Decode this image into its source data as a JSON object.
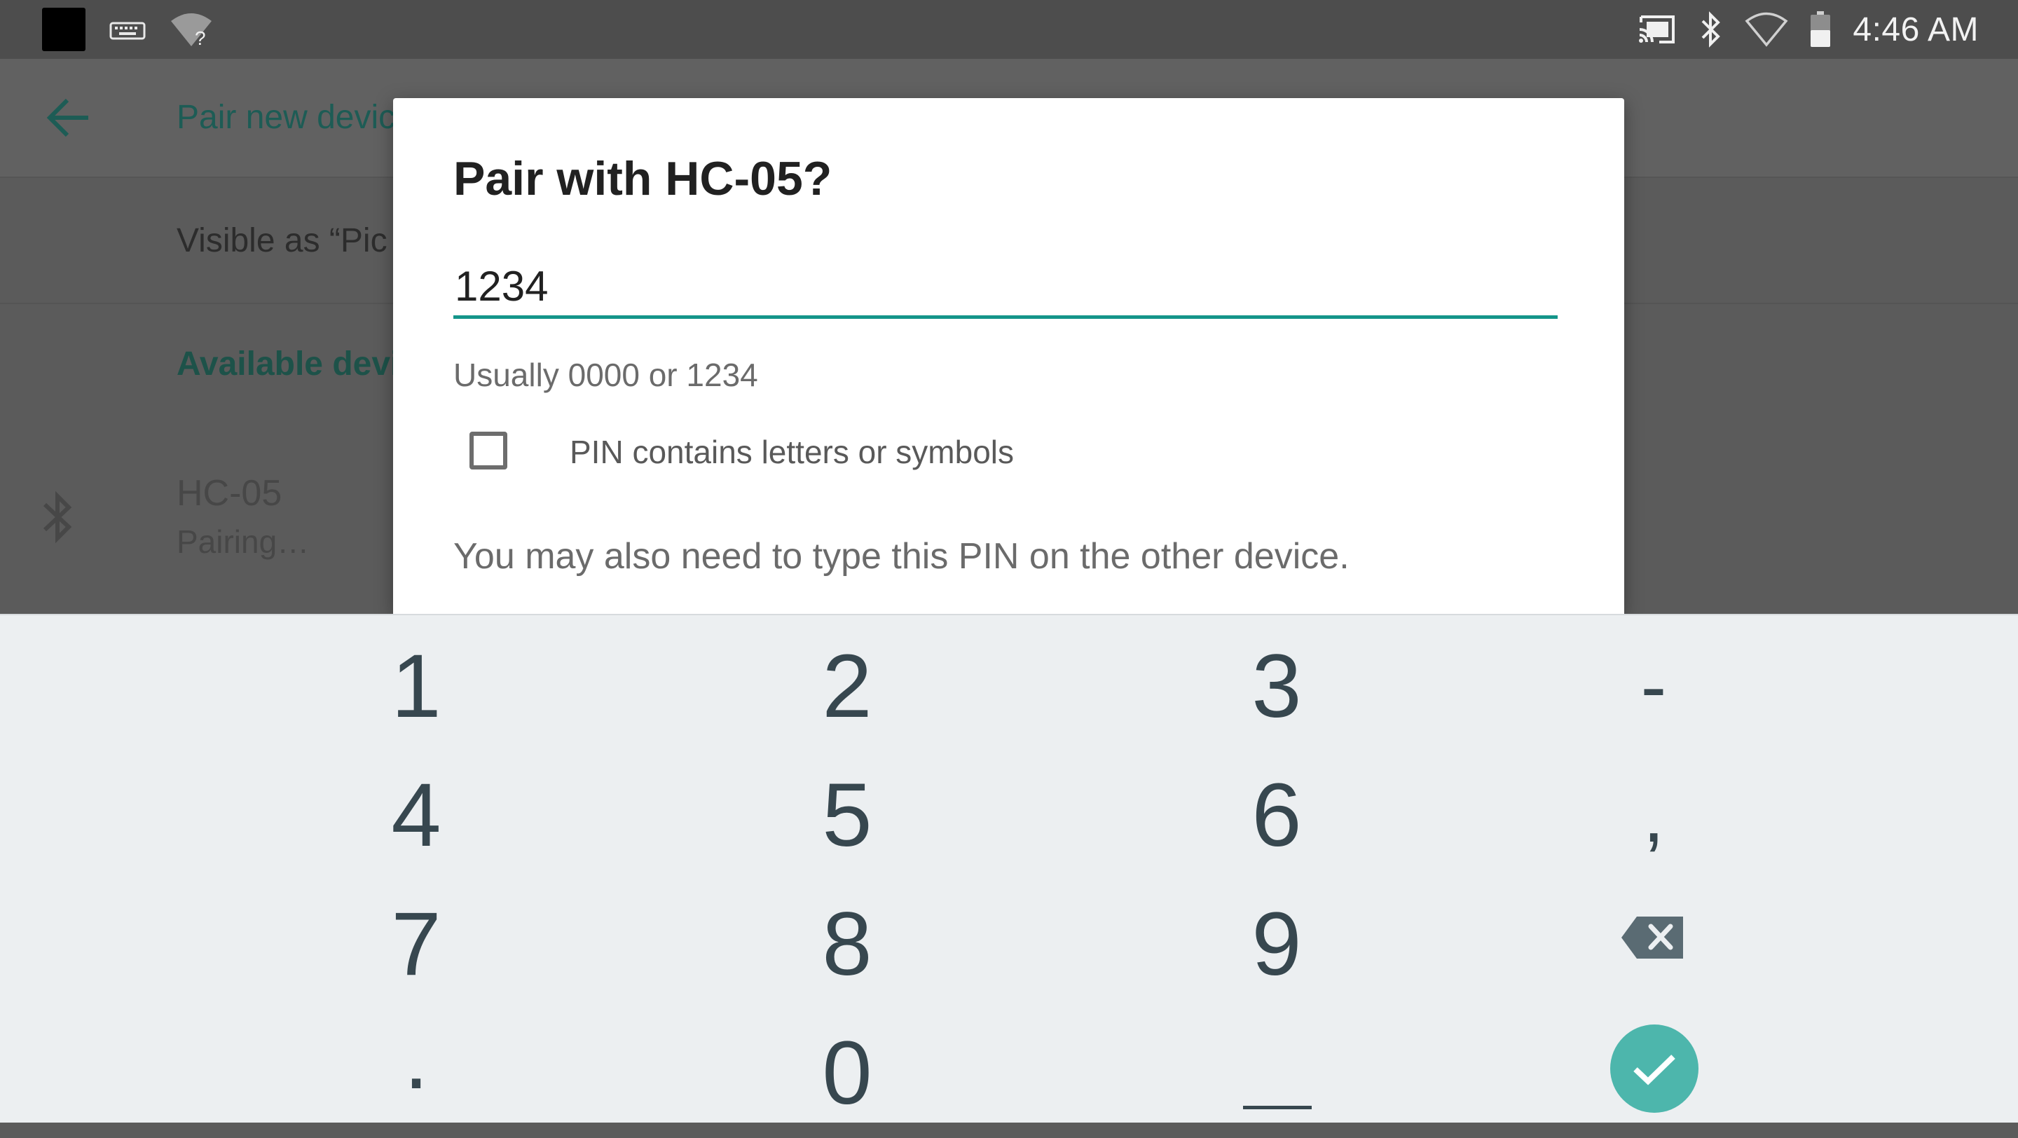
{
  "status_bar": {
    "time": "4:46 AM",
    "left_icons": [
      "notification-square-icon",
      "keyboard-icon",
      "wifi-question-icon"
    ],
    "right_icons": [
      "cast-icon",
      "bluetooth-icon",
      "wifi-icon",
      "battery-icon"
    ]
  },
  "background": {
    "appbar_title": "Pair new device",
    "visible_as": "Visible as “Pic",
    "available_header": "Available devi",
    "device": {
      "name": "HC-05",
      "status": "Pairing…"
    }
  },
  "dialog": {
    "title": "Pair with HC-05?",
    "pin_value": "1234",
    "hint": "Usually 0000 or 1234",
    "checkbox_label": "PIN contains letters or symbols",
    "checkbox_checked": false,
    "info": "You may also need to type this PIN on the other device."
  },
  "keyboard": {
    "keys": {
      "k1": "1",
      "k2": "2",
      "k3": "3",
      "minus": "-",
      "k4": "4",
      "k5": "5",
      "k6": "6",
      "comma": ",",
      "k7": "7",
      "k8": "8",
      "k9": "9",
      "period": ".",
      "k0": "0"
    },
    "special_icons": [
      "backspace-icon",
      "space-icon",
      "enter-checkmark-icon"
    ]
  },
  "colors": {
    "accent": "#14958a",
    "enter_key": "#4db6ac",
    "keyboard_bg": "#eceff1",
    "key_text": "#37474f",
    "scrim_bg": "#5b5b5b"
  }
}
